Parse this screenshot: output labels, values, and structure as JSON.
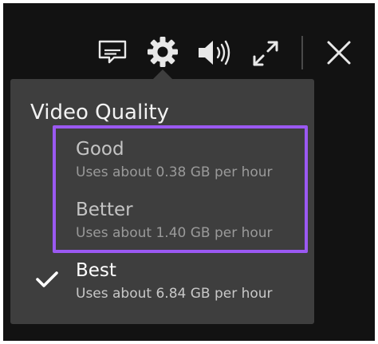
{
  "toolbar": {
    "subtitles_icon": "subtitles-icon",
    "settings_icon": "gear-icon",
    "volume_icon": "volume-icon",
    "fullscreen_icon": "fullscreen-icon",
    "close_icon": "close-icon"
  },
  "menu": {
    "title": "Video Quality",
    "options": [
      {
        "label": "Good",
        "description": "Uses about 0.38 GB per hour",
        "selected": false
      },
      {
        "label": "Better",
        "description": "Uses about 1.40 GB per hour",
        "selected": false
      },
      {
        "label": "Best",
        "description": "Uses about 6.84 GB per hour",
        "selected": true
      }
    ]
  },
  "colors": {
    "player_background": "#121212",
    "menu_background": "#3e3e3e",
    "highlight_border": "#9b59f2",
    "icon": "#e8e8e8"
  }
}
